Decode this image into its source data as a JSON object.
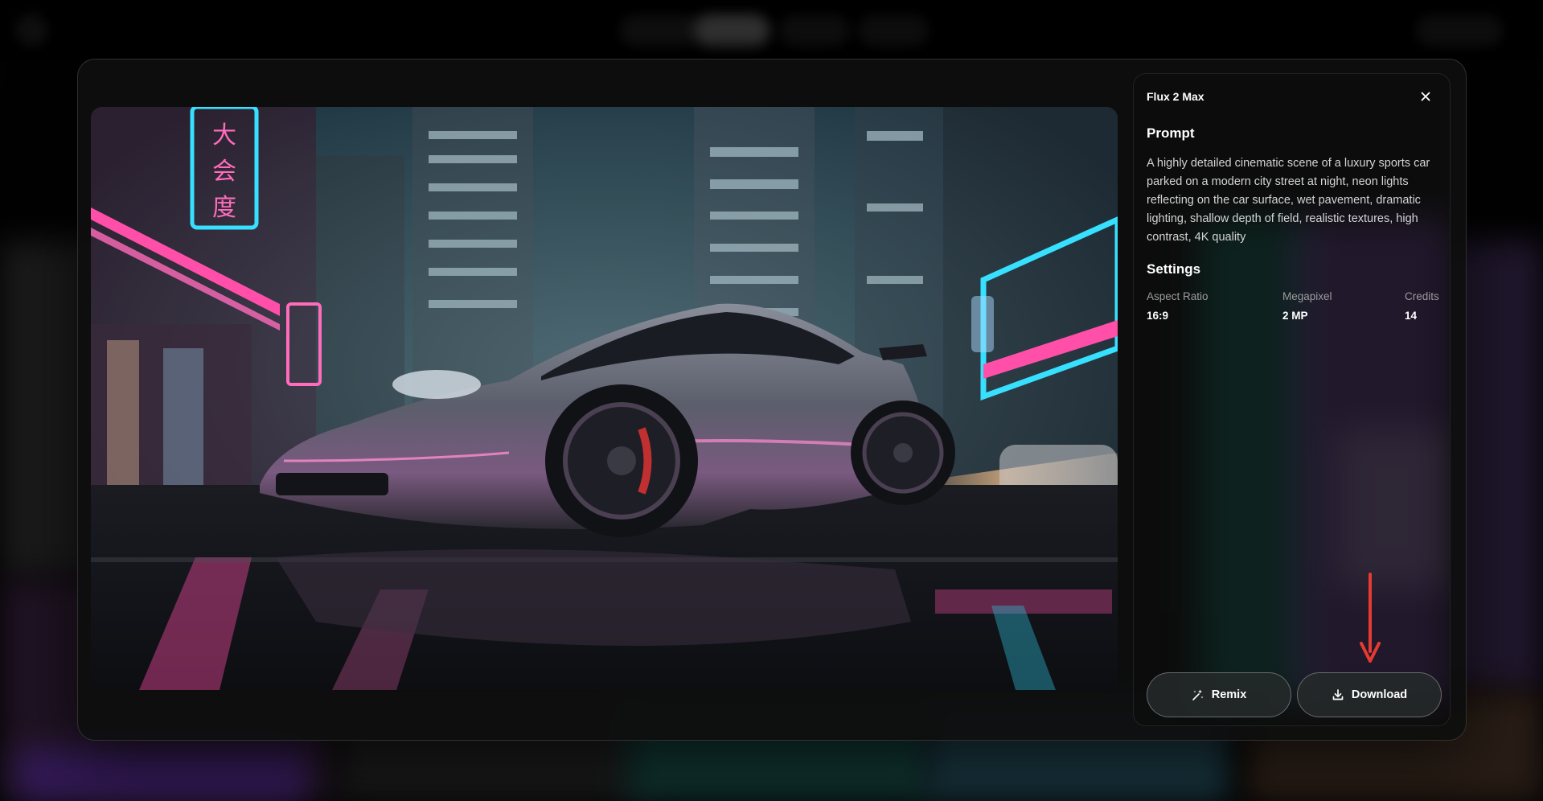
{
  "panel": {
    "model_name": "Flux 2 Max",
    "close_icon": "close-icon"
  },
  "prompt": {
    "heading": "Prompt",
    "text": "A highly detailed cinematic scene of a luxury sports car parked on a modern city street at night, neon lights reflecting on the car surface, wet pavement, dramatic lighting, shallow depth of field, realistic textures, high contrast, 4K quality"
  },
  "settings": {
    "heading": "Settings",
    "items": [
      {
        "label": "Aspect Ratio",
        "value": "16:9"
      },
      {
        "label": "Megapixel",
        "value": "2 MP"
      },
      {
        "label": "Credits",
        "value": "14"
      }
    ]
  },
  "actions": {
    "remix_label": "Remix",
    "remix_icon": "sparkle-icon",
    "download_label": "Download",
    "download_icon": "download-icon"
  },
  "annotation": {
    "arrow_icon": "arrow-down-icon",
    "arrow_color": "#e53b30"
  },
  "colors": {
    "neon_pink": "#ff4fa8",
    "neon_cyan": "#38e0ff",
    "panel_bg": "#0c0c0c"
  },
  "image": {
    "neon_sign_text": "大会度"
  }
}
